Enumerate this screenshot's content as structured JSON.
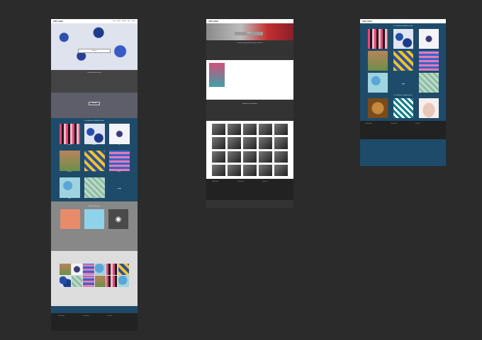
{
  "boards": [
    {
      "logo": "ATB LOGO",
      "nav": [
        "Home",
        "About",
        "Portfolio",
        "Shop",
        "Contact"
      ],
      "hero_cta": "Shop now",
      "intro_text": "Brand text about the studio",
      "band_button": "Find out",
      "collections_title": "Our collections - Available to order",
      "collection_captions": [
        "Stripes",
        "Botanical",
        "Ink",
        "Heritage",
        "Pattern",
        "Tropical",
        "Floral",
        "Geo"
      ],
      "services_title": "What we do for you",
      "footer_cols": [
        "Studio address",
        "Contact details",
        "Social links"
      ]
    },
    {
      "logo": "ATB LOGO",
      "hero_cta": "Portfolio",
      "intro_text": "Description paragraph about the designer and process.",
      "band_text": "Portfolio of work and exhibitions",
      "footer_cols": [
        "Studio address",
        "Contact details",
        "Social links"
      ]
    },
    {
      "logo": "ATB LOGO",
      "section_title": "Our collections - Available to order",
      "section_title_2": "Our collections - Vintage archive",
      "footer_cols": [
        "Studio address",
        "Contact details",
        "Social links"
      ]
    }
  ]
}
